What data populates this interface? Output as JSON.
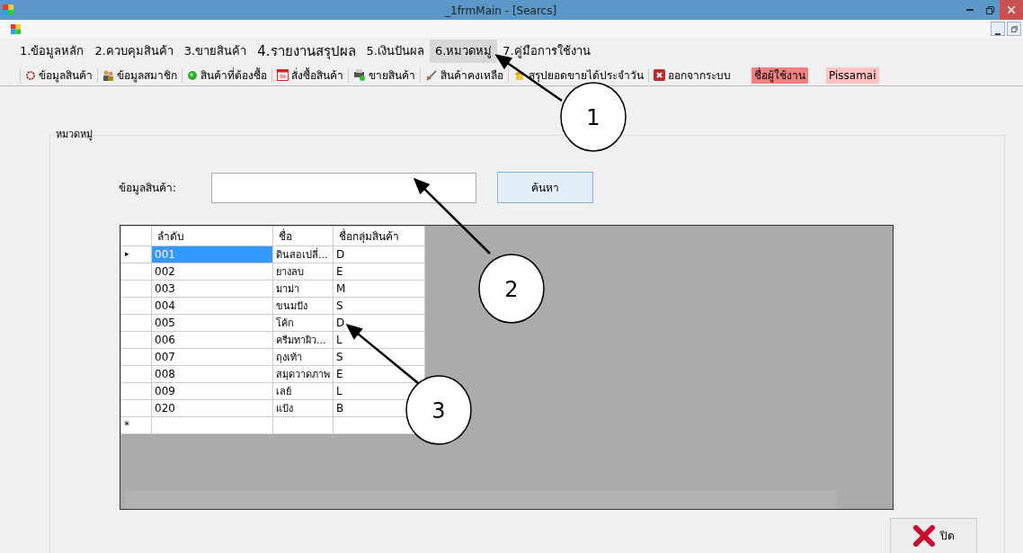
{
  "window": {
    "title": "_1frmMain - [Searcs]"
  },
  "menu": [
    {
      "label": "1.ข้อมูลหลัก",
      "selected": false
    },
    {
      "label": "2.ควบคุมสินค้า",
      "selected": false
    },
    {
      "label": "3.ขายสินค้า",
      "selected": false
    },
    {
      "label": "4.รายงานสรุปผล",
      "selected": false
    },
    {
      "label": "5.เงินปันผล",
      "selected": false
    },
    {
      "label": "6.หมวดหมู่",
      "selected": true
    },
    {
      "label": "7.คู่มือการใช้งาน",
      "selected": false
    }
  ],
  "toolbar": [
    {
      "label": "ข้อมูลสินค้า",
      "kind": "product"
    },
    {
      "label": "ข้อมูลสมาชิก",
      "kind": "member"
    },
    {
      "label": "สินค้าที่ต้องซื้อ",
      "kind": "globe"
    },
    {
      "label": "สั่งซื้อสินค้า",
      "kind": "calendar"
    },
    {
      "label": "ขายสินค้า",
      "kind": "register"
    },
    {
      "label": "สินค้าคงเหลือ",
      "kind": "pen"
    },
    {
      "label": "สรุปยอดขายได้ประจำวัน",
      "kind": "house"
    },
    {
      "label": "ออกจากระบบ",
      "kind": "exit"
    }
  ],
  "user": {
    "label": "ชื่อผู้ใช้งาน",
    "name": "Pissamai"
  },
  "group": {
    "title": "หมวดหมู่"
  },
  "search": {
    "label": "ข้อมูลสินค้า:",
    "button": "ค้นหา"
  },
  "table": {
    "columns": [
      "ลำดับ",
      "ชื่อ",
      "ชื่อกลุ่มสินค้า"
    ],
    "rows": [
      {
        "cells": [
          "001",
          "ดินสอเปลี่...",
          "D"
        ],
        "selected": true
      },
      {
        "cells": [
          "002",
          "ยางลบ",
          "E"
        ],
        "selected": false
      },
      {
        "cells": [
          "003",
          "มาม่า",
          "M"
        ],
        "selected": false
      },
      {
        "cells": [
          "004",
          "ขนมปัง",
          "S"
        ],
        "selected": false
      },
      {
        "cells": [
          "005",
          "โค้ก",
          "D"
        ],
        "selected": false
      },
      {
        "cells": [
          "006",
          "ครีมทาผิว...",
          "L"
        ],
        "selected": false
      },
      {
        "cells": [
          "007",
          "ถุงเท้า",
          "S"
        ],
        "selected": false
      },
      {
        "cells": [
          "008",
          "สมุดวาดภาพ",
          "E"
        ],
        "selected": false
      },
      {
        "cells": [
          "009",
          "เลย์",
          "L"
        ],
        "selected": false
      },
      {
        "cells": [
          "020",
          "แป้ง",
          "B"
        ],
        "selected": false
      }
    ],
    "current_row_marker": "▸",
    "new_row_marker": "*"
  },
  "close_button": {
    "label": "ปิด"
  },
  "callouts": [
    {
      "label": "1"
    },
    {
      "label": "2"
    },
    {
      "label": "3"
    }
  ]
}
